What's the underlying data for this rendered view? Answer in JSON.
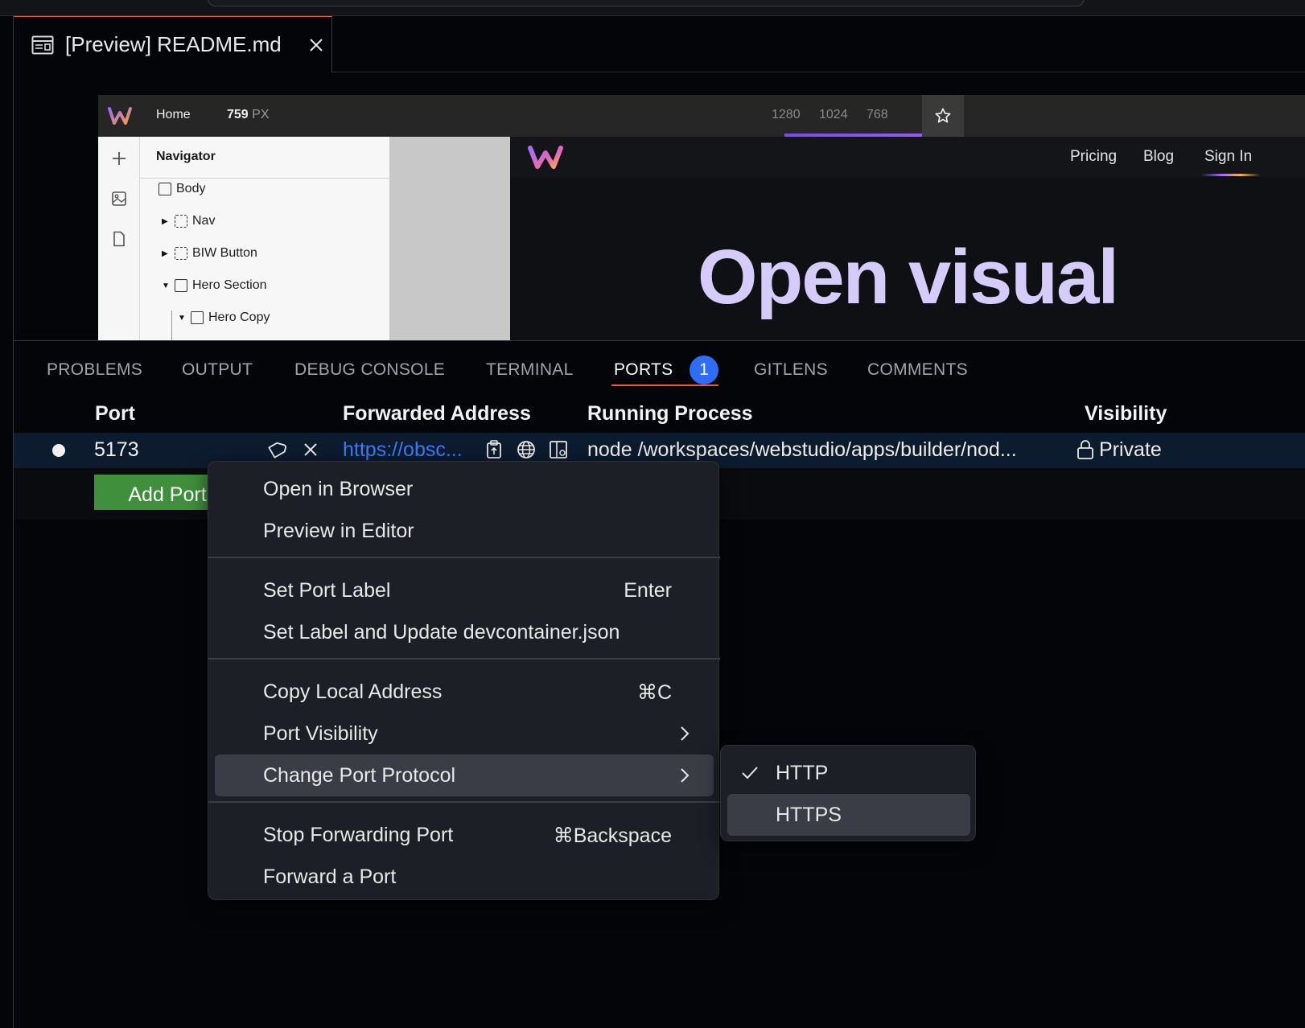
{
  "editor": {
    "tab_title": "[Preview] README.md"
  },
  "webstudio": {
    "home_label": "Home",
    "width_value": "759",
    "width_unit": "PX",
    "breakpoints": [
      "1280",
      "1024",
      "768"
    ],
    "navigator_title": "Navigator",
    "tree": [
      {
        "label": "Body"
      },
      {
        "label": "Nav"
      },
      {
        "label": "BIW Button"
      },
      {
        "label": "Hero Section"
      },
      {
        "label": "Hero Copy"
      }
    ],
    "site_links": [
      "Pricing",
      "Blog",
      "Sign In"
    ],
    "hero_text": "Open visual"
  },
  "panel": {
    "tabs": [
      "PROBLEMS",
      "OUTPUT",
      "DEBUG CONSOLE",
      "TERMINAL",
      "PORTS",
      "GITLENS",
      "COMMENTS"
    ],
    "active_tab": "PORTS",
    "ports_badge": "1",
    "columns": [
      "Port",
      "Forwarded Address",
      "Running Process",
      "Visibility"
    ],
    "row": {
      "port": "5173",
      "forwarded_address": "https://obsc...",
      "running_process": "node /workspaces/webstudio/apps/builder/nod...",
      "visibility": "Private"
    },
    "add_port_label": "Add Port"
  },
  "context_menu": {
    "items": [
      {
        "label": "Open in Browser",
        "shortcut": ""
      },
      {
        "label": "Preview in Editor",
        "shortcut": ""
      },
      {
        "label": "Set Port Label",
        "shortcut": "Enter"
      },
      {
        "label": "Set Label and Update devcontainer.json",
        "shortcut": ""
      },
      {
        "label": "Copy Local Address",
        "shortcut": "⌘C"
      },
      {
        "label": "Port Visibility",
        "shortcut": ""
      },
      {
        "label": "Change Port Protocol",
        "shortcut": ""
      },
      {
        "label": "Stop Forwarding Port",
        "shortcut": "⌘Backspace"
      },
      {
        "label": "Forward a Port",
        "shortcut": ""
      }
    ],
    "highlighted": "Change Port Protocol"
  },
  "protocol_submenu": {
    "items": [
      {
        "label": "HTTP",
        "checked": true
      },
      {
        "label": "HTTPS",
        "checked": false
      }
    ],
    "highlighted": "HTTPS"
  },
  "colors": {
    "accent_orange": "#f0563b",
    "badge_blue": "#2f6df6",
    "link_blue": "#3b7bf5",
    "add_port_green": "#3f8f3c",
    "hero_lavender": "#d6ccfa"
  }
}
